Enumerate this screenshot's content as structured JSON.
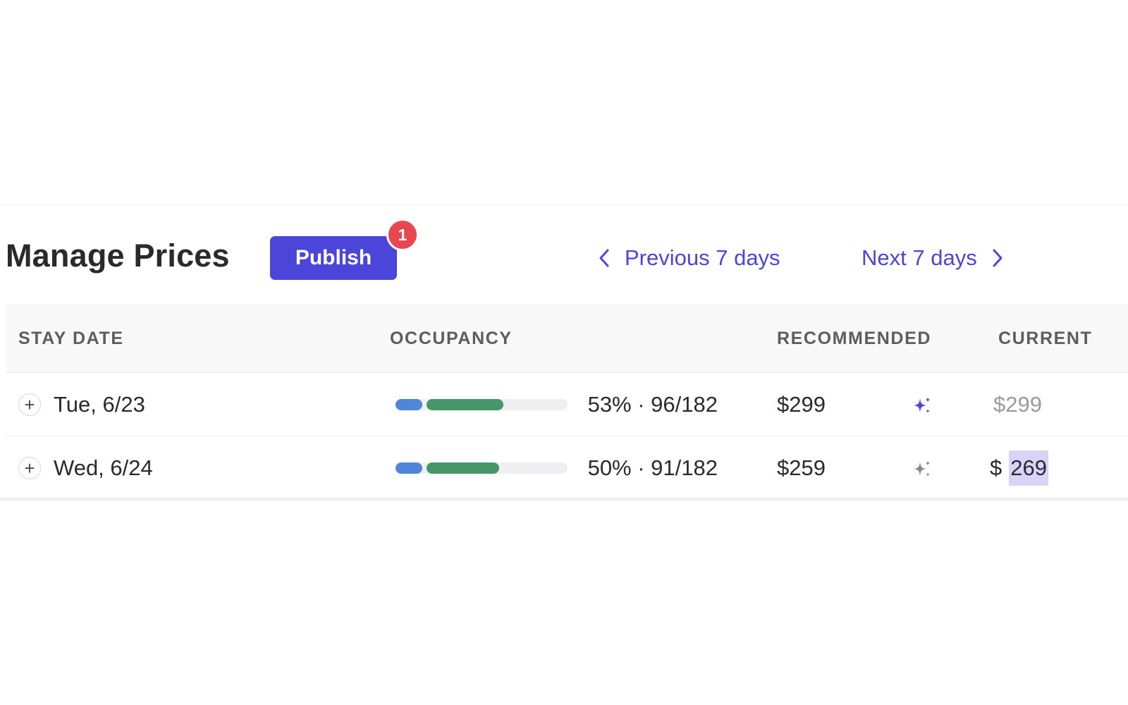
{
  "header": {
    "title": "Manage Prices",
    "publish_label": "Publish",
    "publish_badge": "1",
    "prev_label": "Previous 7 days",
    "next_label": "Next 7 days"
  },
  "table": {
    "columns": [
      "STAY DATE",
      "OCCUPANCY",
      "RECOMMENDED",
      "CURRENT"
    ],
    "rows": [
      {
        "expand": "+",
        "date": "Tue, 6/23",
        "occupancy_pct": 53,
        "occupancy_text": "53% · 96/182",
        "recommended": "$299",
        "recommendation_icon": "sparkle-icon",
        "recommendation_applied": true,
        "current": "$299"
      },
      {
        "expand": "+",
        "date": "Wed, 6/24",
        "occupancy_pct": 50,
        "occupancy_text": "50% · 91/182",
        "recommended": "$259",
        "recommendation_icon": "sparkle-icon",
        "recommendation_applied": false,
        "current_symbol": "$",
        "current_value": "269"
      }
    ]
  },
  "colors": {
    "accent": "#4b45d9",
    "badge": "#e8474f",
    "occupancy_blue": "#4f86d8",
    "occupancy_green": "#46966a",
    "sparkle_active": "#4b45d9",
    "sparkle_inactive": "#8a8a90",
    "selection": "#d8d3f7"
  }
}
